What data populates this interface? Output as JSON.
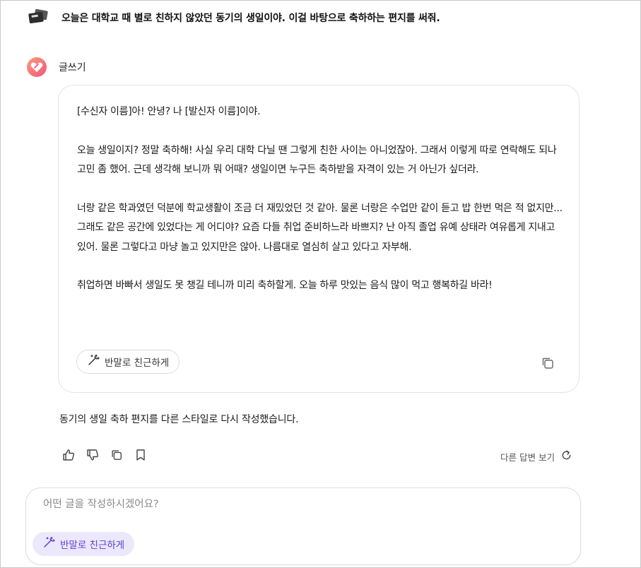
{
  "user_message": "오늘은 대학교 때 별로 친하지 않았던 동기의 생일이야. 이걸 바탕으로 축하하는 편지를 써줘.",
  "assistant_label": "글쓰기",
  "letter": {
    "paragraphs": [
      "[수신자 이름]아! 안녕? 나 [발신자 이름]이야.",
      "오늘 생일이지? 정말 축하해! 사실 우리 대학 다닐 땐 그렇게 친한 사이는 아니었잖아. 그래서 이렇게 따로 연락해도 되나 고민 좀 했어. 근데 생각해 보니까 뭐 어때? 생일이면 누구든 축하받을 자격이 있는 거 아닌가 싶더라.",
      "너랑 같은 학과였던 덕분에 학교생활이 조금 더 재밌었던 것 같아. 물론 너랑은 수업만 같이 듣고 밥 한번 먹은 적 없지만... 그래도 같은 공간에 있었다는 게 어디야? 요즘 다들 취업 준비하느라 바쁘지? 난 아직 졸업 유예 상태라 여유롭게 지내고 있어. 물론 그렇다고 마냥 놀고 있지만은 않아. 나름대로 열심히 살고 있다고 자부해.",
      "취업하면 바빠서 생일도 못 챙길 테니까 미리 축하할게. 오늘 하루 맛있는 음식 많이 먹고 행복하길 바라!"
    ],
    "style_chip_label": "반말로 친근하게"
  },
  "summary": "동기의 생일 축하 편지를 다른 스타일로 다시 작성했습니다.",
  "actions": {
    "icons": [
      "thumbs-up-icon",
      "thumbs-down-icon",
      "copy-icon",
      "bookmark-icon"
    ],
    "regenerate_label": "다른 답변 보기"
  },
  "input": {
    "placeholder": "어떤 글을 작성하시겠어요?",
    "value": "",
    "style_chip_label": "반말로 친근하게"
  },
  "colors": {
    "accent": "#5b3fd6",
    "accent_bg": "#ece8fb",
    "logo_gradient_start": "#ff9a7a",
    "logo_gradient_end": "#f0567a"
  }
}
